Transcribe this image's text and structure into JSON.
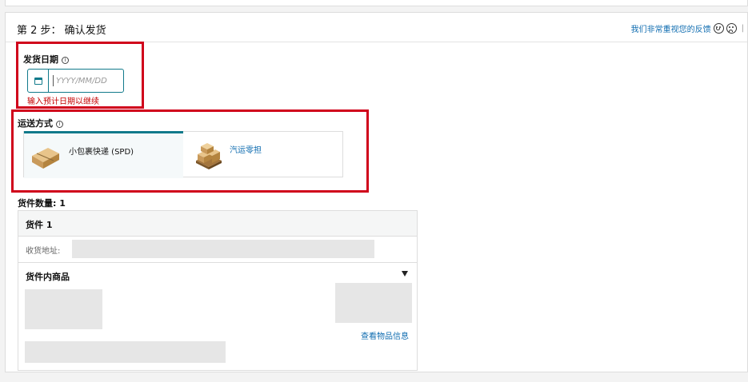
{
  "step": {
    "title": "第 2 步： 确认发货"
  },
  "feedback": {
    "text": "我们非常重视您的反馈",
    "separator": "|"
  },
  "ship_date": {
    "label": "发货日期",
    "placeholder": "YYYY/MM/DD",
    "error": "输入预计日期以继续"
  },
  "shipping_method": {
    "label": "运送方式",
    "options": [
      {
        "label": "小包裹快递 (SPD)",
        "selected": true
      },
      {
        "label": "汽运零担",
        "selected": false
      }
    ]
  },
  "shipment_count": {
    "label": "货件数量: 1"
  },
  "shipment": {
    "title": "货件 1",
    "address_label": "收货地址:",
    "items_label": "货件内商品",
    "view_link": "查看物品信息"
  },
  "colors": {
    "accent": "#117a8b",
    "link": "#0f6cb0",
    "error": "#c40000",
    "highlight": "#d0021b"
  }
}
